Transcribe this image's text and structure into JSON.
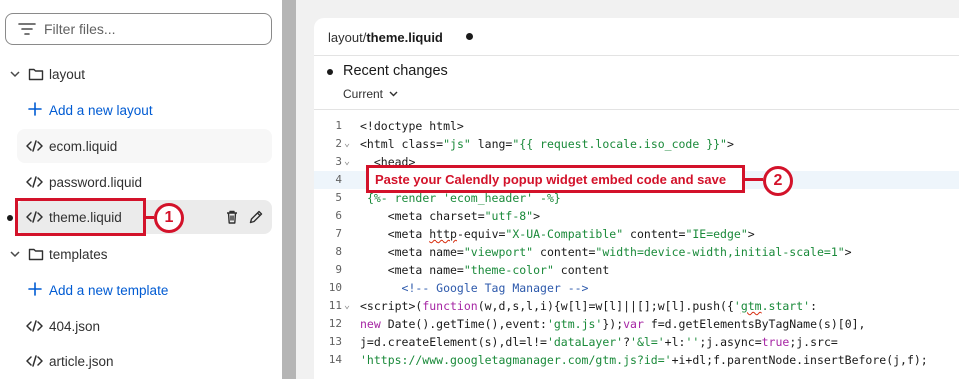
{
  "sidebar": {
    "filter_placeholder": "Filter files...",
    "items": [
      {
        "type": "folder",
        "label": "layout"
      },
      {
        "type": "add",
        "label": "Add a new layout"
      },
      {
        "type": "file",
        "label": "ecom.liquid"
      },
      {
        "type": "file",
        "label": "password.liquid"
      },
      {
        "type": "file",
        "label": "theme.liquid",
        "active": true
      },
      {
        "type": "folder",
        "label": "templates"
      },
      {
        "type": "add",
        "label": "Add a new template"
      },
      {
        "type": "file",
        "label": "404.json"
      },
      {
        "type": "file",
        "label": "article.json"
      }
    ]
  },
  "editor": {
    "tab": {
      "path": "layout/",
      "filename": "theme.liquid"
    },
    "recent_changes": "Recent changes",
    "version": "Current",
    "lines": [
      {
        "n": "1",
        "fold": false
      },
      {
        "n": "2",
        "fold": true
      },
      {
        "n": "3",
        "fold": true
      },
      {
        "n": "4",
        "fold": false
      },
      {
        "n": "5",
        "fold": false
      },
      {
        "n": "6",
        "fold": false
      },
      {
        "n": "7",
        "fold": false
      },
      {
        "n": "8",
        "fold": false
      },
      {
        "n": "9",
        "fold": false
      },
      {
        "n": "10",
        "fold": false
      },
      {
        "n": "11",
        "fold": true
      },
      {
        "n": "12",
        "fold": false
      },
      {
        "n": "13",
        "fold": false
      },
      {
        "n": "14",
        "fold": false
      }
    ]
  },
  "annotations": {
    "step1": "1",
    "step2": "2",
    "step2_text": "Paste your Calendly popup widget embed code and save",
    "color": "#d3122a"
  }
}
